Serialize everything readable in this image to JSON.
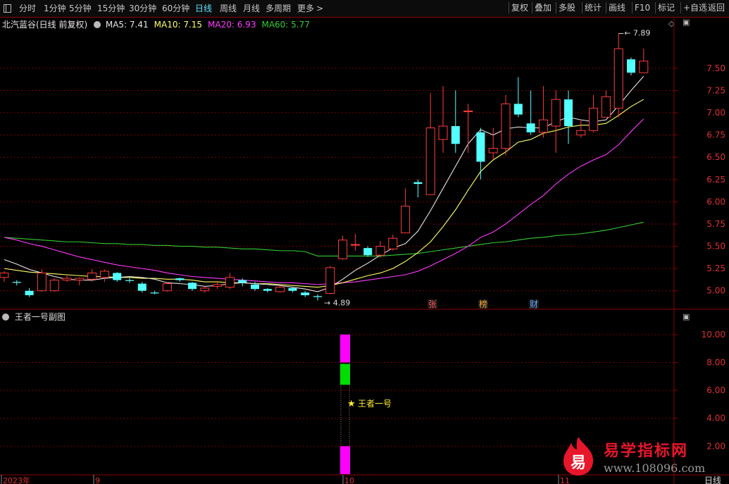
{
  "toolbar": {
    "periods": [
      "分时",
      "1分钟",
      "5分钟",
      "15分钟",
      "30分钟",
      "60分钟",
      "日线",
      "周线",
      "月线",
      "多周期",
      "更多"
    ],
    "active_period": "日线",
    "more_icon": "chevron-right-icon",
    "right_buttons": [
      "复权",
      "叠加",
      "多股",
      "统计",
      "画线",
      "F10",
      "标记",
      "+自选",
      "返回"
    ]
  },
  "chart_header": {
    "stock_name": "北汽蓝谷(日线 前复权)",
    "ma": [
      {
        "label": "MA5: 7.41",
        "color": "#e6e6e6"
      },
      {
        "label": "MA10: 7.15",
        "color": "#ffff66"
      },
      {
        "label": "MA20: 6.93",
        "color": "#ff3bff"
      },
      {
        "label": "MA60: 5.77",
        "color": "#33cc33"
      }
    ]
  },
  "price_axis": [
    "7.50",
    "7.25",
    "7.00",
    "6.75",
    "6.50",
    "6.25",
    "6.00",
    "5.75",
    "5.50",
    "5.25",
    "5.00"
  ],
  "annotations": {
    "high": "7.89",
    "low": "4.89"
  },
  "event_markers": [
    {
      "label": "张",
      "color": "#ff5555"
    },
    {
      "label": "榜",
      "color": "#ffaa33"
    },
    {
      "label": "财",
      "color": "#66aaff"
    }
  ],
  "sub_panel": {
    "title": "王者一号副图",
    "axis": [
      "10.00",
      "8.00",
      "6.00",
      "4.00",
      "2.00"
    ],
    "signal_label": "王者一号"
  },
  "date_axis": {
    "labels": [
      "2023年",
      "9",
      "10",
      "11"
    ],
    "unit": "日线"
  },
  "watermark": {
    "title": "易学指标网",
    "url": "www.108096.com",
    "logo_char": "易"
  },
  "colors": {
    "up": "#ff3c3c",
    "down": "#54ffff",
    "grid": "#7a0000",
    "axis": "#8b0000"
  },
  "chart_data": {
    "type": "candlestick",
    "candles": [
      [
        5.15,
        5.2,
        5.1,
        5.22
      ],
      [
        5.1,
        5.09,
        5.06,
        5.12
      ],
      [
        5.0,
        4.95,
        4.93,
        5.03
      ],
      [
        5.0,
        5.2,
        4.99,
        5.24
      ],
      [
        5.0,
        5.12,
        4.99,
        5.14
      ],
      [
        5.12,
        5.14,
        5.1,
        5.17
      ],
      [
        5.12,
        5.14,
        5.06,
        5.15
      ],
      [
        5.13,
        5.2,
        5.1,
        5.24
      ],
      [
        5.15,
        5.22,
        5.1,
        5.24
      ],
      [
        5.2,
        5.12,
        5.1,
        5.21
      ],
      [
        5.12,
        5.11,
        5.09,
        5.14
      ],
      [
        5.08,
        5.0,
        4.98,
        5.1
      ],
      [
        4.98,
        4.97,
        4.96,
        5.0
      ],
      [
        5.0,
        5.08,
        4.99,
        5.1
      ],
      [
        5.14,
        5.12,
        5.1,
        5.15
      ],
      [
        5.09,
        5.02,
        5.0,
        5.1
      ],
      [
        5.0,
        5.03,
        4.98,
        5.05
      ],
      [
        5.05,
        5.07,
        5.02,
        5.1
      ],
      [
        5.04,
        5.15,
        5.02,
        5.2
      ],
      [
        5.12,
        5.09,
        5.05,
        5.14
      ],
      [
        5.07,
        5.02,
        5.0,
        5.1
      ],
      [
        5.02,
        5.0,
        4.98,
        5.03
      ],
      [
        4.99,
        5.04,
        4.98,
        5.06
      ],
      [
        5.03,
        5.0,
        4.98,
        5.04
      ],
      [
        4.98,
        4.95,
        4.93,
        5.0
      ],
      [
        4.94,
        4.93,
        4.89,
        4.96
      ],
      [
        4.97,
        5.26,
        4.96,
        5.28
      ],
      [
        5.36,
        5.57,
        5.35,
        5.62
      ],
      [
        5.52,
        5.52,
        5.45,
        5.64
      ],
      [
        5.48,
        5.4,
        5.38,
        5.5
      ],
      [
        5.4,
        5.5,
        5.37,
        5.56
      ],
      [
        5.47,
        5.59,
        5.45,
        5.63
      ],
      [
        5.65,
        5.95,
        5.65,
        6.15
      ],
      [
        6.22,
        6.2,
        6.05,
        6.25
      ],
      [
        6.08,
        6.83,
        6.08,
        7.22
      ],
      [
        6.7,
        6.85,
        6.55,
        7.3
      ],
      [
        6.85,
        6.65,
        6.55,
        7.25
      ],
      [
        7.02,
        7.02,
        6.55,
        7.1
      ],
      [
        6.78,
        6.45,
        6.25,
        6.83
      ],
      [
        6.55,
        6.6,
        6.47,
        6.83
      ],
      [
        6.6,
        7.1,
        6.52,
        7.2
      ],
      [
        7.1,
        6.98,
        6.95,
        7.4
      ],
      [
        6.88,
        6.78,
        6.75,
        7.25
      ],
      [
        6.78,
        6.92,
        6.72,
        7.3
      ],
      [
        6.85,
        7.15,
        6.55,
        7.25
      ],
      [
        7.15,
        6.85,
        6.65,
        7.25
      ],
      [
        6.75,
        6.8,
        6.72,
        6.92
      ],
      [
        6.8,
        7.05,
        6.78,
        7.2
      ],
      [
        6.95,
        7.18,
        6.95,
        7.25
      ],
      [
        7.05,
        7.72,
        6.95,
        7.89
      ],
      [
        7.6,
        7.45,
        7.42,
        7.62
      ],
      [
        7.45,
        7.58,
        7.45,
        7.72
      ]
    ],
    "ma5": [
      5.35,
      5.3,
      5.24,
      5.2,
      5.16,
      5.13,
      5.12,
      5.12,
      5.14,
      5.15,
      5.16,
      5.15,
      5.13,
      5.09,
      5.08,
      5.07,
      5.05,
      5.06,
      5.08,
      5.09,
      5.08,
      5.07,
      5.06,
      5.04,
      5.02,
      4.99,
      5.04,
      5.13,
      5.23,
      5.31,
      5.4,
      5.48,
      5.53,
      5.67,
      5.9,
      6.15,
      6.4,
      6.65,
      6.81,
      6.75,
      6.82,
      6.84,
      6.83,
      6.83,
      6.9,
      6.95,
      6.92,
      6.9,
      6.92,
      7.08,
      7.25,
      7.41
    ],
    "ma10": [
      5.25,
      5.23,
      5.21,
      5.2,
      5.19,
      5.18,
      5.17,
      5.16,
      5.16,
      5.15,
      5.15,
      5.14,
      5.14,
      5.13,
      5.13,
      5.12,
      5.1,
      5.1,
      5.09,
      5.09,
      5.08,
      5.08,
      5.07,
      5.06,
      5.05,
      5.04,
      5.06,
      5.09,
      5.13,
      5.17,
      5.2,
      5.25,
      5.33,
      5.43,
      5.55,
      5.72,
      5.91,
      6.13,
      6.34,
      6.47,
      6.56,
      6.67,
      6.7,
      6.77,
      6.8,
      6.84,
      6.86,
      6.86,
      6.88,
      6.97,
      7.07,
      7.15
    ],
    "ma20": [
      5.6,
      5.57,
      5.53,
      5.5,
      5.46,
      5.42,
      5.38,
      5.35,
      5.32,
      5.29,
      5.27,
      5.25,
      5.23,
      5.2,
      5.18,
      5.16,
      5.15,
      5.14,
      5.13,
      5.12,
      5.11,
      5.1,
      5.09,
      5.09,
      5.08,
      5.07,
      5.08,
      5.09,
      5.1,
      5.12,
      5.14,
      5.16,
      5.18,
      5.22,
      5.28,
      5.35,
      5.42,
      5.5,
      5.6,
      5.66,
      5.75,
      5.86,
      5.97,
      6.07,
      6.2,
      6.31,
      6.4,
      6.47,
      6.53,
      6.64,
      6.79,
      6.93
    ],
    "ma60": [
      5.6,
      5.59,
      5.58,
      5.57,
      5.56,
      5.55,
      5.55,
      5.54,
      5.53,
      5.53,
      5.52,
      5.52,
      5.51,
      5.51,
      5.5,
      5.5,
      5.49,
      5.49,
      5.48,
      5.47,
      5.47,
      5.46,
      5.45,
      5.45,
      5.44,
      5.39,
      5.39,
      5.39,
      5.39,
      5.39,
      5.39,
      5.4,
      5.41,
      5.42,
      5.44,
      5.46,
      5.48,
      5.5,
      5.52,
      5.54,
      5.55,
      5.57,
      5.59,
      5.6,
      5.62,
      5.63,
      5.64,
      5.66,
      5.68,
      5.71,
      5.74,
      5.77
    ],
    "ylim": [
      4.8,
      7.95
    ],
    "sub_chart": {
      "ylim": [
        0,
        11
      ],
      "blocks": [
        {
          "from": 8.0,
          "to": 10.0,
          "color": "#ff00ff"
        },
        {
          "from": 6.4,
          "to": 7.9,
          "color": "#00dd00"
        },
        {
          "from": 0.0,
          "to": 2.0,
          "color": "#ff00ff"
        }
      ]
    }
  }
}
